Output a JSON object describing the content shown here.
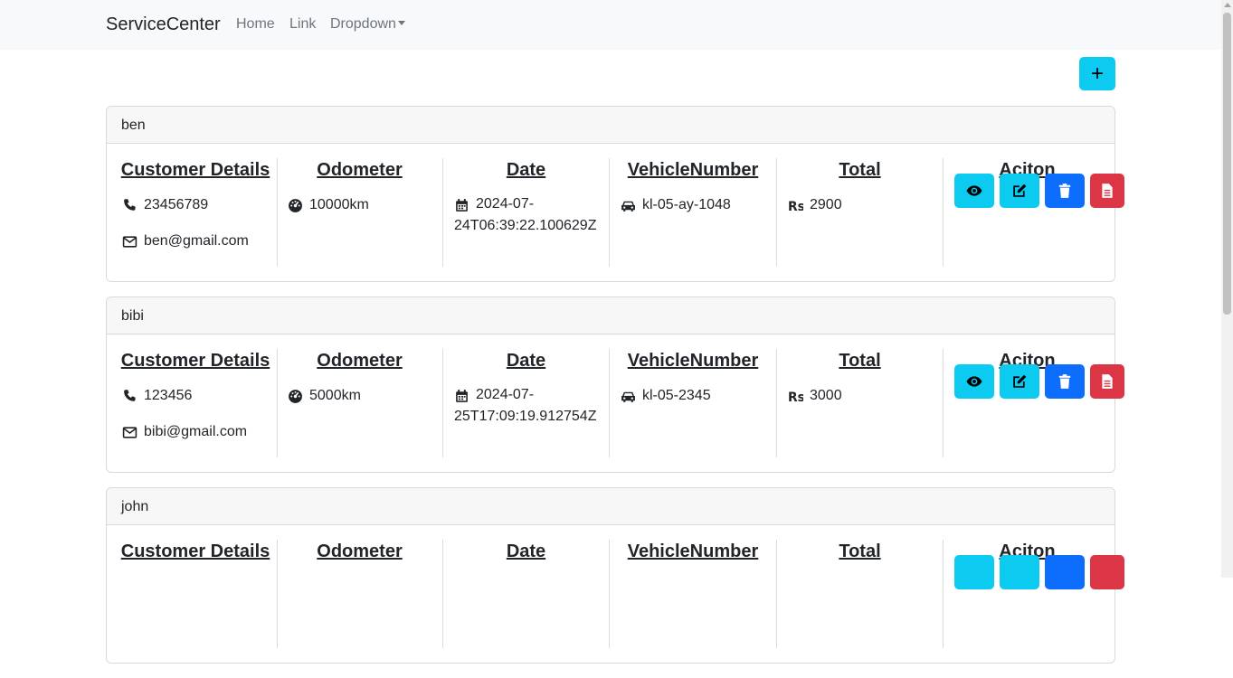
{
  "navbar": {
    "brand": "ServiceCenter",
    "links": [
      "Home",
      "Link",
      "Dropdown"
    ]
  },
  "add_button_label": "+",
  "columns": {
    "customer": "Customer Details",
    "odometer": "Odometer",
    "date": "Date",
    "vehicle": "VehicleNumber",
    "total": "Total",
    "action": "Aciton"
  },
  "records": [
    {
      "name": "ben",
      "phone": "23456789",
      "email": "ben@gmail.com",
      "odometer": "10000km",
      "date_line1": "2024-07-",
      "date_line2": "24T06:39:22.100629Z",
      "vehicle": "kl-05-ay-1048",
      "total": "2900"
    },
    {
      "name": "bibi",
      "phone": "123456",
      "email": "bibi@gmail.com",
      "odometer": "5000km",
      "date_line1": "2024-07-",
      "date_line2": "25T17:09:19.912754Z",
      "vehicle": "kl-05-2345",
      "total": "3000"
    },
    {
      "name": "john"
    }
  ],
  "colors": {
    "info": "#0dcaf0",
    "primary": "#0d6efd",
    "danger": "#dc3545"
  },
  "icons": [
    "phone-icon",
    "envelope-icon",
    "gauge-icon",
    "calendar-icon",
    "car-icon",
    "rupee-icon",
    "eye-icon",
    "edit-icon",
    "trash-icon",
    "file-icon"
  ]
}
